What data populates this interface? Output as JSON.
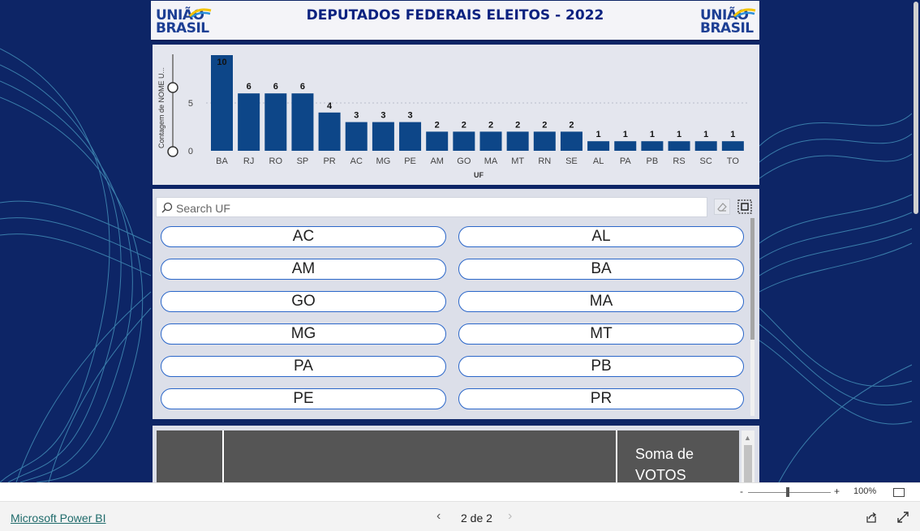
{
  "header": {
    "title": "DEPUTADOS FEDERAIS ELEITOS - 2022",
    "logo_line1": "UNIÃO",
    "logo_line2": "BRASIL"
  },
  "chart_data": {
    "type": "bar",
    "title": "",
    "xlabel": "UF",
    "ylabel": "Contagem de NOME U...",
    "categories": [
      "BA",
      "RJ",
      "RO",
      "SP",
      "PR",
      "AC",
      "MG",
      "PE",
      "AM",
      "GO",
      "MA",
      "MT",
      "RN",
      "SE",
      "AL",
      "PA",
      "PB",
      "RS",
      "SC",
      "TO"
    ],
    "values": [
      10,
      6,
      6,
      6,
      4,
      3,
      3,
      3,
      2,
      2,
      2,
      2,
      2,
      2,
      1,
      1,
      1,
      1,
      1,
      1
    ],
    "yticks": [
      0,
      5
    ],
    "ylim": [
      0,
      10
    ],
    "grid": true,
    "bar_color": "#0d4688"
  },
  "slicer": {
    "search_placeholder": "Search UF",
    "items": [
      "AC",
      "AL",
      "AM",
      "BA",
      "GO",
      "MA",
      "MG",
      "MT",
      "PA",
      "PB",
      "PE",
      "PR"
    ]
  },
  "table": {
    "sum_header": "Soma de VOTOS"
  },
  "zoom": {
    "minus": "-",
    "plus": "+",
    "percent": "100%"
  },
  "footer": {
    "brand": "Microsoft Power BI",
    "page_label": "2 de 2",
    "prev": "‹",
    "next": "›"
  }
}
